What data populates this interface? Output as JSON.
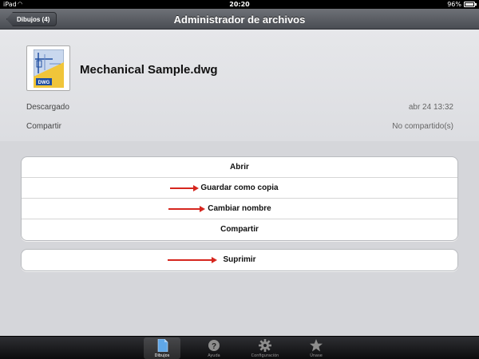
{
  "status_bar": {
    "carrier": "iPad",
    "time": "20:20",
    "battery": "96%"
  },
  "nav_bar": {
    "back_label": "Dibujos (4)",
    "title": "Administrador de archivos"
  },
  "file": {
    "name": "Mechanical Sample.dwg",
    "thumb_label": "DWG",
    "rows": [
      {
        "label": "Descargado",
        "value": "abr 24 13:32"
      },
      {
        "label": "Compartir",
        "value": "No compartido(s)"
      }
    ]
  },
  "actions": {
    "open": "Abrir",
    "save_copy": "Guardar como copia",
    "rename": "Cambiar nombre",
    "share": "Compartir",
    "delete": "Suprimir"
  },
  "tabs": [
    {
      "label": "Dibujos",
      "icon": "document-icon",
      "active": true
    },
    {
      "label": "Ayuda",
      "icon": "help-icon",
      "active": false
    },
    {
      "label": "Configuración",
      "icon": "gear-icon",
      "active": false
    },
    {
      "label": "Únase",
      "icon": "star-icon",
      "active": false
    }
  ],
  "colors": {
    "annotation_arrow": "#d6261e",
    "nav_bar": "#5a5d63",
    "background": "#d5d6da"
  }
}
